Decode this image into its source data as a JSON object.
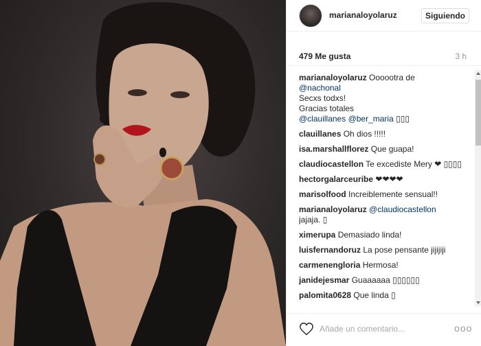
{
  "header": {
    "username": "marianaloyolaruz",
    "follow_label": "Siguiendo"
  },
  "post": {
    "likes": "479 Me gusta",
    "time": "3 h"
  },
  "caption": {
    "user": "marianaloyolaruz",
    "line1": "Oooootra de",
    "mention1": "@nachonal",
    "line2": "Secxs todxs!",
    "line3": "Gracias totales",
    "mention2": "@clauillanes",
    "mention3": "@ber_maria",
    "emoji": "▯▯▯"
  },
  "comments": [
    {
      "user": "clauillanes",
      "text": "Oh dios !!!!!"
    },
    {
      "user": "isa.marshallflorez",
      "text": "Que guapa!"
    },
    {
      "user": "claudiocastellon",
      "text": "Te excediste Mery ❤ ▯▯▯▯"
    },
    {
      "user": "hectorgalarceuribe",
      "text": "❤❤❤❤"
    },
    {
      "user": "marisolfood",
      "text": "Increiblemente sensual!!"
    },
    {
      "user": "marianaloyolaruz",
      "mention": "@claudiocastellon",
      "text": "jajaja. ▯"
    },
    {
      "user": "ximerupa",
      "text": "Demasiado linda!"
    },
    {
      "user": "luisfernandoruz",
      "text": "La pose pensante jijijiji"
    },
    {
      "user": "carmenengloria",
      "text": "Hermosa!"
    },
    {
      "user": "janidejesmar",
      "text": "Guaaaaaa ▯▯▯▯▯▯"
    },
    {
      "user": "palomita0628",
      "text": "Que linda ▯"
    }
  ],
  "footer": {
    "comment_placeholder": "Añade un comentario...",
    "more_label": "ooo"
  },
  "icons": {
    "like": "heart-icon",
    "options": "more-options-icon"
  },
  "colors": {
    "mention": "#003569",
    "text": "#262626",
    "muted": "#999999"
  }
}
